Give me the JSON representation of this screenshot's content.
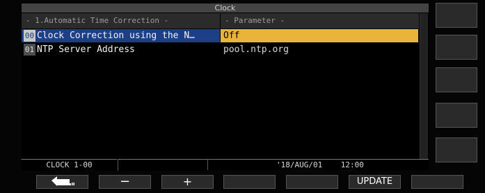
{
  "window": {
    "title": "Clock"
  },
  "columns": {
    "left": "- 1.Automatic Time Correction -",
    "right": "- Parameter -"
  },
  "rows": [
    {
      "num": "00",
      "name": "Clock Correction using the N…",
      "value": "Off",
      "selected": true
    },
    {
      "num": "01",
      "name": "NTP Server Address",
      "value": "pool.ntp.org",
      "selected": false
    }
  ],
  "status": {
    "page": "CLOCK 1-00",
    "datetime": "'18/AUG/01    12:00"
  },
  "function_keys": [
    {
      "label": "",
      "icon": "return-arrow-icon"
    },
    {
      "label": "−"
    },
    {
      "label": "+"
    },
    {
      "label": ""
    },
    {
      "label": ""
    },
    {
      "label": "UPDATE"
    },
    {
      "label": ""
    }
  ],
  "colors": {
    "selected_bg": "#e9b43a",
    "title_bg": "#444444"
  }
}
